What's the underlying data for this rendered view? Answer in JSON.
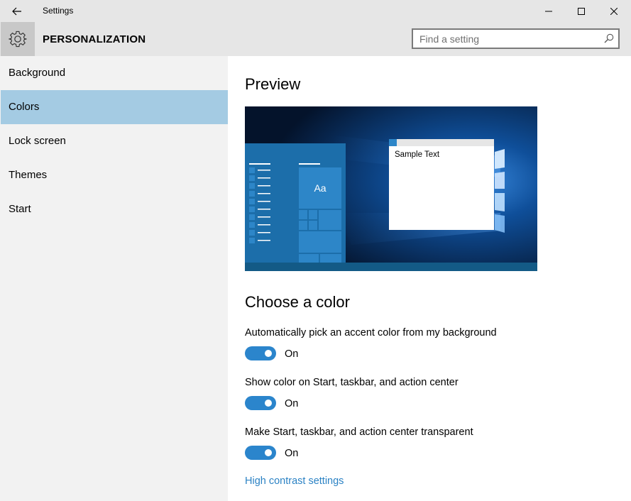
{
  "window": {
    "title": "Settings",
    "minimize_icon": "minimize-icon",
    "maximize_icon": "maximize-icon",
    "close_icon": "close-icon",
    "back_icon": "back-arrow-icon"
  },
  "header": {
    "section_title": "PERSONALIZATION",
    "section_icon": "gear-icon"
  },
  "search": {
    "placeholder": "Find a setting",
    "value": "",
    "icon": "search-icon"
  },
  "sidebar": {
    "items": [
      {
        "label": "Background",
        "selected": false
      },
      {
        "label": "Colors",
        "selected": true
      },
      {
        "label": "Lock screen",
        "selected": false
      },
      {
        "label": "Themes",
        "selected": false
      },
      {
        "label": "Start",
        "selected": false
      }
    ]
  },
  "main": {
    "preview_heading": "Preview",
    "preview": {
      "tile_text": "Aa",
      "sample_text": "Sample Text"
    },
    "choose_heading": "Choose a color",
    "options": [
      {
        "label": "Automatically pick an accent color from my background",
        "state": "On",
        "on": true
      },
      {
        "label": "Show color on Start, taskbar, and action center",
        "state": "On",
        "on": true
      },
      {
        "label": "Make Start, taskbar, and action center transparent",
        "state": "On",
        "on": true
      }
    ],
    "link": "High contrast settings"
  },
  "colors": {
    "accent": "#2b85cc",
    "selected_nav": "#a4cbe3",
    "link": "#2b82c4",
    "sidebar_bg": "#f2f2f2",
    "titlebar_bg": "#e6e6e6"
  }
}
